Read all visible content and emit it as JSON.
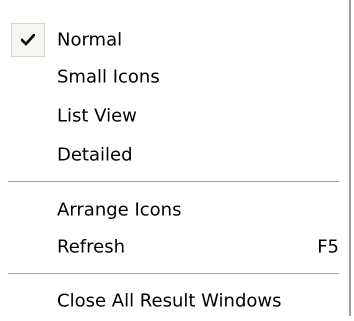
{
  "menu": {
    "items": [
      {
        "label": "Normal",
        "checked": true
      },
      {
        "label": "Small Icons"
      },
      {
        "label": "List View"
      },
      {
        "label": "Detailed"
      },
      {
        "label": "Arrange Icons"
      },
      {
        "label": "Refresh",
        "shortcut": "F5"
      },
      {
        "label": "Close All Result Windows"
      }
    ],
    "check_icon": "checkmark-icon"
  }
}
